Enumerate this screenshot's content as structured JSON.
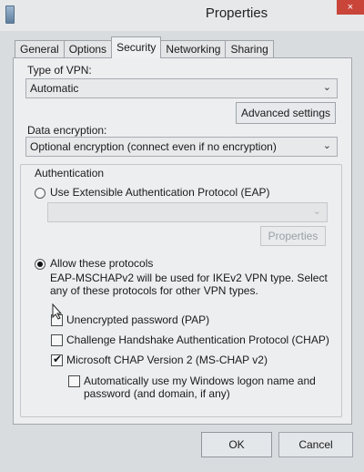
{
  "window": {
    "title": "Properties",
    "close_symbol": "×",
    "close_icon": "close-icon",
    "app_icon": "network-icon"
  },
  "tabs": [
    {
      "label": "General"
    },
    {
      "label": "Options"
    },
    {
      "label": "Security",
      "active": true
    },
    {
      "label": "Networking"
    },
    {
      "label": "Sharing"
    }
  ],
  "vpn_type": {
    "label": "Type of VPN:",
    "value": "Automatic"
  },
  "advanced_settings_label": "Advanced settings",
  "encryption": {
    "label": "Data encryption:",
    "value": "Optional encryption (connect even if no encryption)"
  },
  "auth": {
    "heading": "Authentication",
    "eap_label": "Use Extensible Authentication Protocol (EAP)",
    "eap_select_value": "",
    "properties_label": "Properties",
    "allow_label": "Allow these protocols",
    "note_line1": "EAP-MSCHAPv2 will be used for IKEv2 VPN type. Select",
    "note_line2": "any of these protocols for other VPN types.",
    "pap_label": "Unencrypted password (PAP)",
    "chap_label": "Challenge Handshake Authentication Protocol (CHAP)",
    "mschap_label": "Microsoft CHAP Version 2 (MS-CHAP v2)",
    "auto_logon_line1": "Automatically use my Windows logon name and",
    "auto_logon_line2": "password (and domain, if any)"
  },
  "footer": {
    "ok_label": "OK",
    "cancel_label": "Cancel"
  },
  "chevron_glyph": "⌄"
}
